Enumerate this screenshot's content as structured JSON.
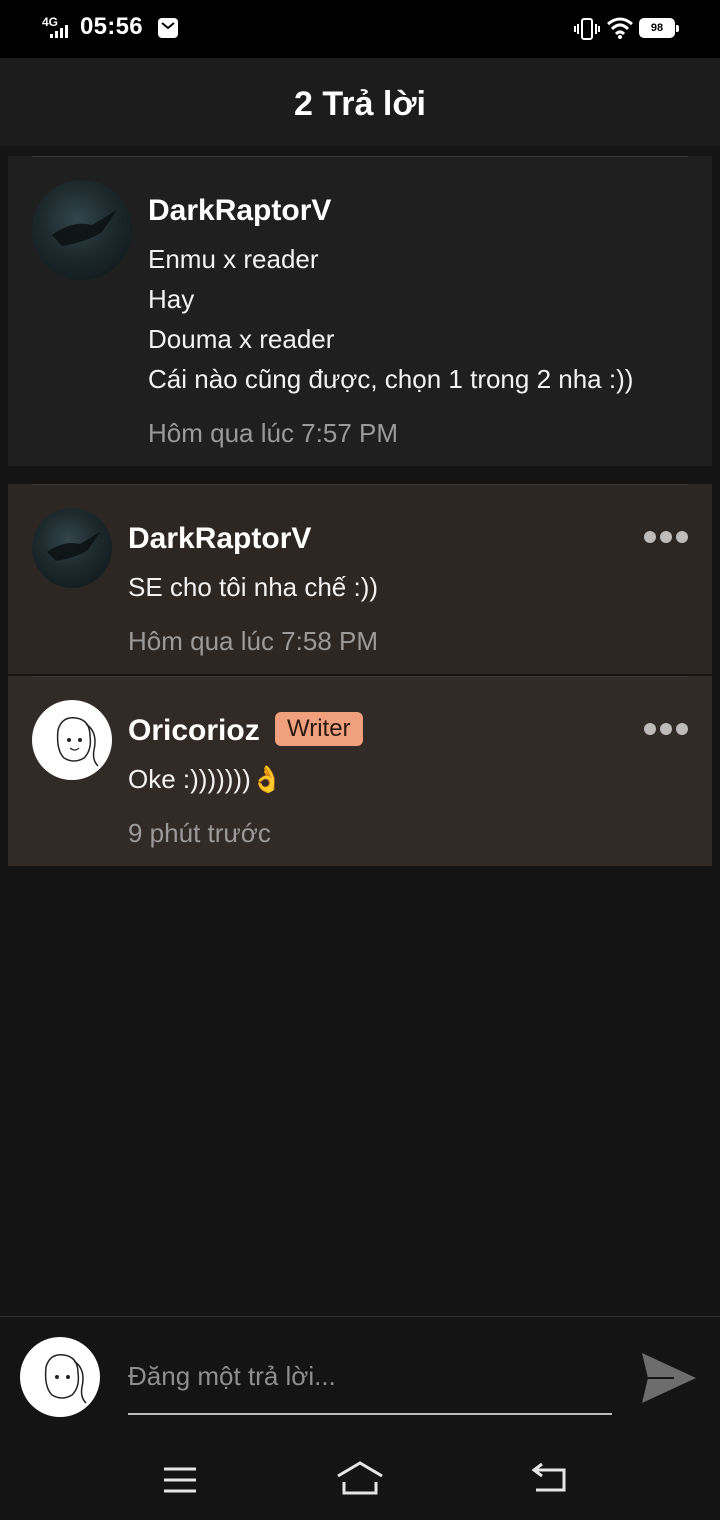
{
  "status_bar": {
    "network": "4G",
    "time": "05:56",
    "battery": "98"
  },
  "header": {
    "title": "2 Trả lời"
  },
  "parent_comment": {
    "author": "DarkRaptorV",
    "lines": [
      "Enmu x reader",
      "Hay",
      "Douma x reader",
      "Cái nào cũng được, chọn 1 trong 2 nha :))"
    ],
    "time": "Hôm qua lúc 7:57 PM"
  },
  "replies": [
    {
      "author": "DarkRaptorV",
      "text": "SE cho tôi nha chế :))",
      "time": "Hôm qua lúc 7:58 PM"
    },
    {
      "author": "Oricorioz",
      "badge": "Writer",
      "text": "Oke :)))))))👌",
      "time": "9 phút trước"
    }
  ],
  "composer": {
    "placeholder": "Đăng một trả lời..."
  },
  "colors": {
    "background": "#141414",
    "header": "#1c1c1c",
    "parent_card": "#1f1f1f",
    "reply_card": "#2c2723",
    "writer_badge": "#f0a07c",
    "secondary_text": "#9a9a9a"
  }
}
